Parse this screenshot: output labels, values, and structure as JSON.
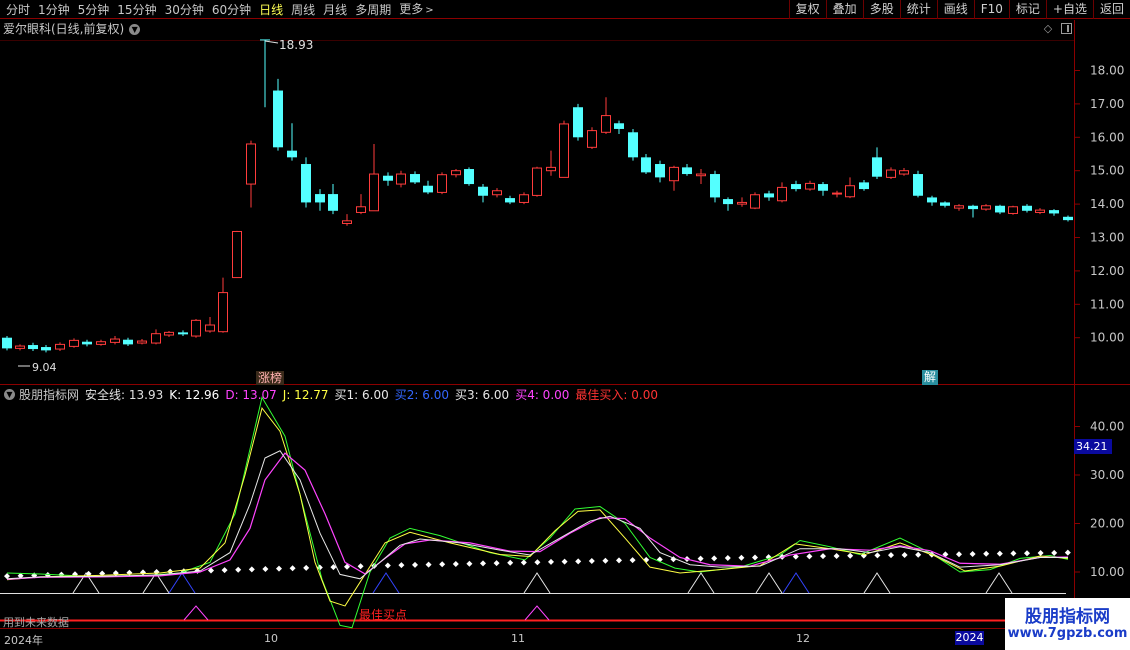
{
  "toolbar": {
    "periods": [
      "分时",
      "1分钟",
      "5分钟",
      "15分钟",
      "30分钟",
      "60分钟",
      "日线",
      "周线",
      "月线",
      "多周期",
      "更多"
    ],
    "active_period": "日线",
    "actions": [
      "复权",
      "叠加",
      "多股",
      "统计",
      "画线",
      "F10",
      "标记",
      "+自选",
      "返回"
    ]
  },
  "main": {
    "title": "爱尔眼科(日线,前复权)",
    "price_ticks": [
      "18.00",
      "17.00",
      "16.00",
      "15.00",
      "14.00",
      "13.00",
      "12.00",
      "11.00",
      "10.00"
    ],
    "high_label": "18.93",
    "low_label": "9.04",
    "marker_limit_up": "涨榜",
    "marker_unlock": "解"
  },
  "indicator": {
    "name": "股朋指标网",
    "fields": [
      {
        "label": "安全线",
        "value": "13.93",
        "color": "#e0e0e0"
      },
      {
        "label": "K",
        "value": "12.96",
        "color": "#ffffff"
      },
      {
        "label": "D",
        "value": "13.07",
        "color": "#ff44ff"
      },
      {
        "label": "J",
        "value": "12.77",
        "color": "#ffff44"
      },
      {
        "label": "买1",
        "value": "6.00",
        "color": "#e8e8e8"
      },
      {
        "label": "买2",
        "value": "6.00",
        "color": "#3366ff"
      },
      {
        "label": "买3",
        "value": "6.00",
        "color": "#e8e8e8"
      },
      {
        "label": "买4",
        "value": "0.00",
        "color": "#ff44ff"
      },
      {
        "label": "最佳买入",
        "value": "0.00",
        "color": "#ff3333"
      }
    ],
    "ticks": [
      "40.00",
      "30.00",
      "20.00",
      "10.00"
    ],
    "cursor_value": "34.21",
    "best_buy_label": "最佳买点",
    "future_data_label": "用到未来数据"
  },
  "time_axis": {
    "year_start": "2024年",
    "months": [
      "10",
      "11",
      "12"
    ],
    "year_badge": "2024"
  },
  "watermark": {
    "title": "股朋指标网",
    "url": "www.7gpzb.com"
  },
  "colors": {
    "up": "#ff3c3c",
    "down": "#54ffff",
    "frame": "#8b0000",
    "k_line": "#e8e8e8",
    "d_line": "#ff44ff",
    "j_line": "#ffff44",
    "green_line": "#33ff33"
  }
}
